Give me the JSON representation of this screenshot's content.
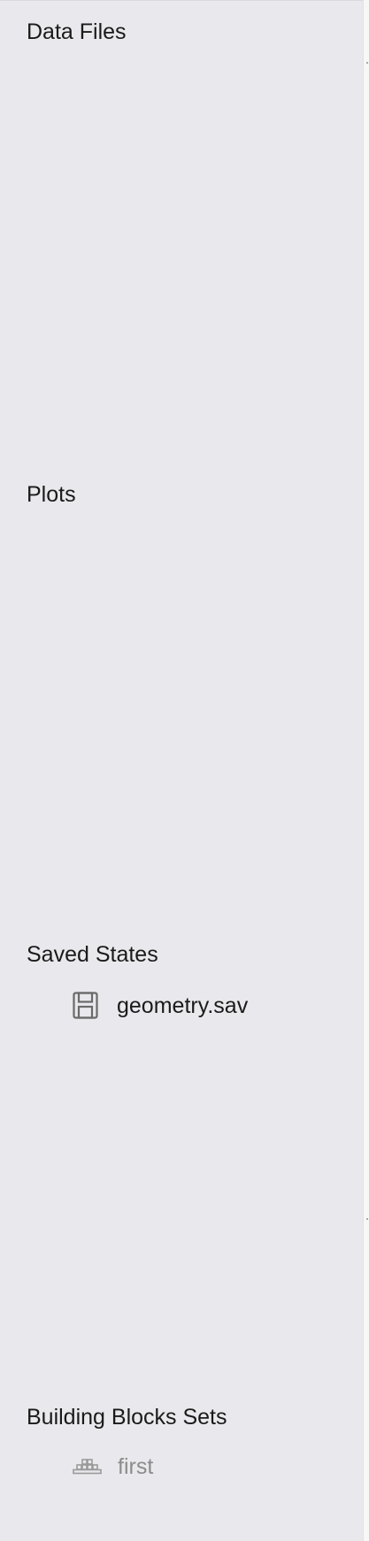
{
  "sections": {
    "data_files": {
      "title": "Data Files"
    },
    "plots": {
      "title": "Plots"
    },
    "saved_states": {
      "title": "Saved States",
      "items": [
        {
          "label": "geometry.sav",
          "icon": "save-file-icon"
        }
      ]
    },
    "building_blocks_sets": {
      "title": "Building Blocks Sets",
      "items": [
        {
          "label": "first",
          "icon": "building-blocks-icon"
        }
      ]
    }
  }
}
